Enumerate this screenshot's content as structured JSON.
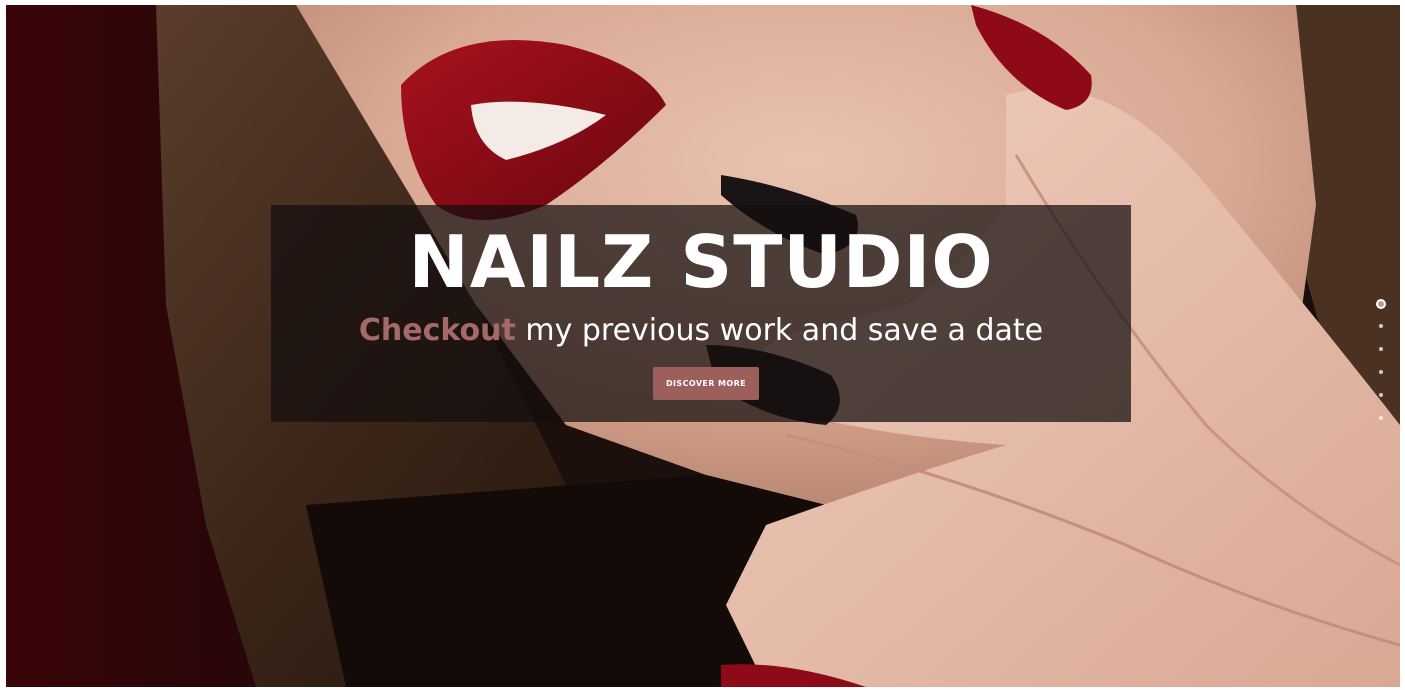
{
  "hero": {
    "title": "NAILZ STUDIO",
    "tagline_accent": "Checkout",
    "tagline_rest": " my previous work and save a date",
    "cta_label": "DISCOVER MORE"
  },
  "slider": {
    "slide_count": 6,
    "active_index": 0
  },
  "colors": {
    "accent": "#a46a67",
    "button": "#9d5f5c",
    "overlay": "#140e0e"
  }
}
